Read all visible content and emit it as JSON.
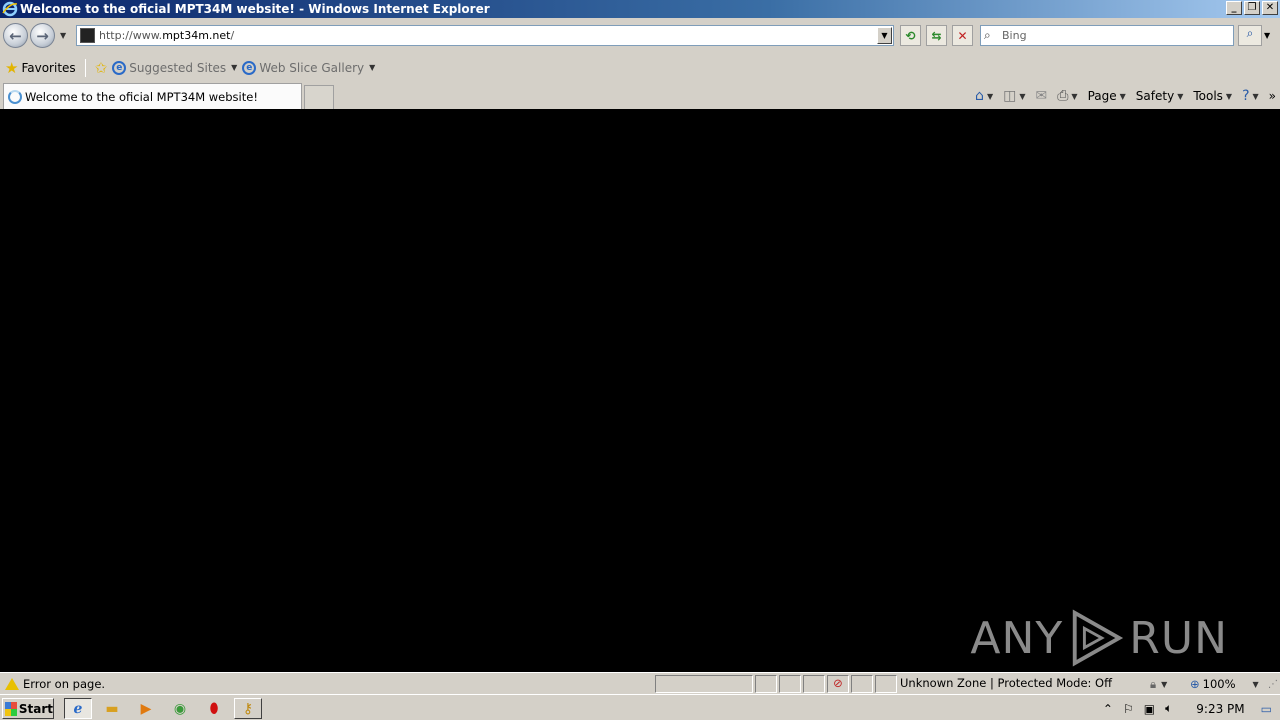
{
  "window": {
    "title": "Welcome to the oficial MPT34M website! - Windows Internet Explorer",
    "controls": [
      "minimize",
      "restore",
      "close"
    ]
  },
  "address_bar": {
    "url_prefix": "http://www.",
    "url_domain": "mpt34m.net",
    "url_suffix": "/"
  },
  "search": {
    "placeholder": "Bing"
  },
  "favorites_bar": {
    "favorites_label": "Favorites",
    "suggested_sites_label": "Suggested Sites",
    "web_slice_label": "Web Slice Gallery"
  },
  "tabs": [
    {
      "label": "Welcome to the oficial MPT34M website!"
    }
  ],
  "command_bar": {
    "page_label": "Page",
    "safety_label": "Safety",
    "tools_label": "Tools"
  },
  "watermark": {
    "left": "ANY",
    "right": "RUN"
  },
  "status_bar": {
    "message": "Error on page.",
    "zone": "Unknown Zone | Protected Mode: Off",
    "zoom": "100%"
  },
  "taskbar": {
    "start_label": "Start",
    "clock": "9:23 PM"
  },
  "colors": {
    "title_gradient_start": "#0a246a",
    "content_background": "#000000",
    "chrome_background": "#d4d0c8"
  }
}
